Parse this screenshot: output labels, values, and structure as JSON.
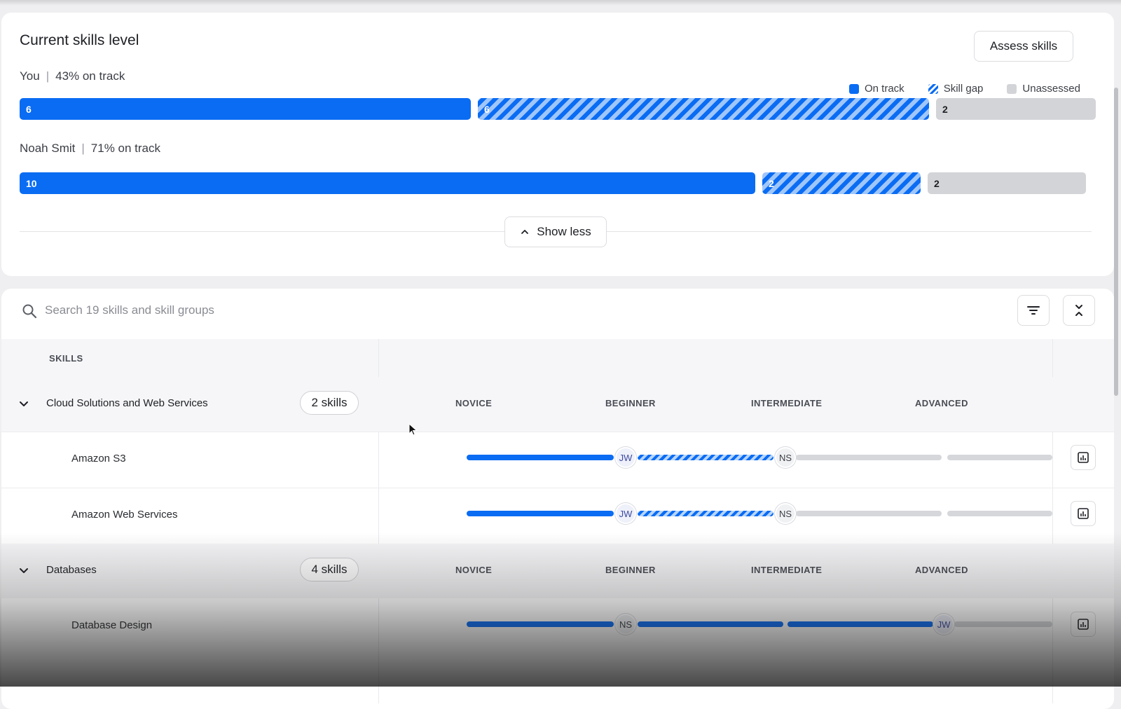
{
  "summary": {
    "title": "Current skills level",
    "assess_button": "Assess skills",
    "legend": [
      {
        "label": "On track",
        "swatch": "on-track"
      },
      {
        "label": "Skill gap",
        "swatch": "skill-gap"
      },
      {
        "label": "Unassessed",
        "swatch": "unassessed"
      }
    ],
    "people": [
      {
        "name": "You",
        "status": "43% on track",
        "on_track": "6",
        "skill_gap": "6",
        "unassessed": "2"
      },
      {
        "name": "Noah Smit",
        "status": "71% on track",
        "on_track": "10",
        "skill_gap": "2",
        "unassessed": "2"
      }
    ],
    "show_less": "Show less"
  },
  "skills": {
    "search_placeholder": "Search 19 skills and skill groups",
    "column_header": "SKILLS",
    "levels": [
      "NOVICE",
      "BEGINNER",
      "INTERMEDIATE",
      "ADVANCED"
    ],
    "groups": [
      {
        "name": "Cloud Solutions and Web Services",
        "count": "2 skills",
        "skills": [
          {
            "name": "Amazon S3",
            "you": "JW",
            "other": "NS"
          },
          {
            "name": "Amazon Web Services",
            "you": "JW",
            "other": "NS"
          }
        ]
      },
      {
        "name": "Databases",
        "count": "4 skills",
        "skills": [
          {
            "name": "Database Design",
            "you": "JW",
            "other": "NS"
          }
        ]
      }
    ]
  },
  "colors": {
    "accent": "#0a6cf3",
    "unassessed": "#d3d4d8"
  },
  "icons": [
    "search-icon",
    "filter-icon",
    "collapse-icon",
    "chevron-up-icon",
    "chevron-down-icon",
    "chart-icon"
  ]
}
